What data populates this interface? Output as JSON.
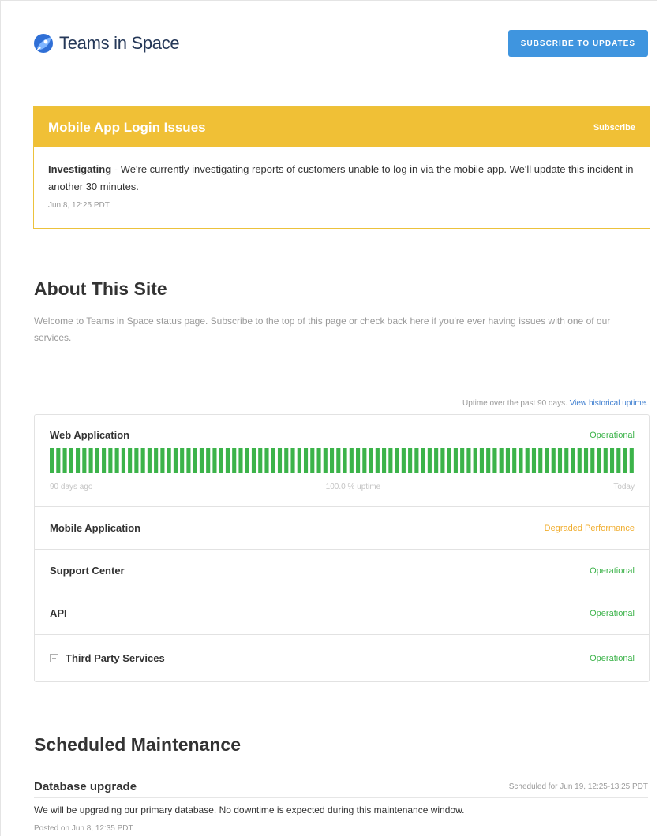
{
  "header": {
    "logo_text": "Teams in Space",
    "subscribe_label": "SUBSCRIBE TO UPDATES"
  },
  "incident": {
    "title": "Mobile App Login Issues",
    "subscribe_label": "Subscribe",
    "status": "Investigating",
    "message": " - We're currently investigating reports of customers unable to log in via the mobile app. We'll update this incident in another 30 minutes.",
    "timestamp": "Jun 8, 12:25 PDT"
  },
  "about": {
    "title": "About This Site",
    "description": "Welcome to Teams in Space status page. Subscribe to the top of this page or check back here if you're ever having issues with one of our services."
  },
  "uptime": {
    "note": "Uptime over the past 90 days.",
    "link": "View historical uptime.",
    "start_label": "90 days ago",
    "middle_label": "100.0 % uptime",
    "end_label": "Today",
    "days": 90,
    "bar_color": "#3cb34a"
  },
  "components": [
    {
      "name": "Web Application",
      "status": "Operational",
      "status_type": "ok"
    },
    {
      "name": "Mobile Application",
      "status": "Degraded Performance",
      "status_type": "degraded"
    },
    {
      "name": "Support Center",
      "status": "Operational",
      "status_type": "ok"
    },
    {
      "name": "API",
      "status": "Operational",
      "status_type": "ok"
    },
    {
      "name": "Third Party Services",
      "status": "Operational",
      "status_type": "ok",
      "expandable": true
    }
  ],
  "maintenance": {
    "title": "Scheduled Maintenance",
    "name": "Database upgrade",
    "scheduled": "Scheduled for Jun 19, 12:25-13:25 PDT",
    "body": "We will be upgrading our primary database. No downtime is expected during this maintenance window.",
    "posted": "Posted on Jun 8, 12:35 PDT"
  },
  "colors": {
    "accent": "#3f95df",
    "incident": "#f0c036",
    "operational": "#3cb34a",
    "degraded": "#f0ad2e"
  }
}
